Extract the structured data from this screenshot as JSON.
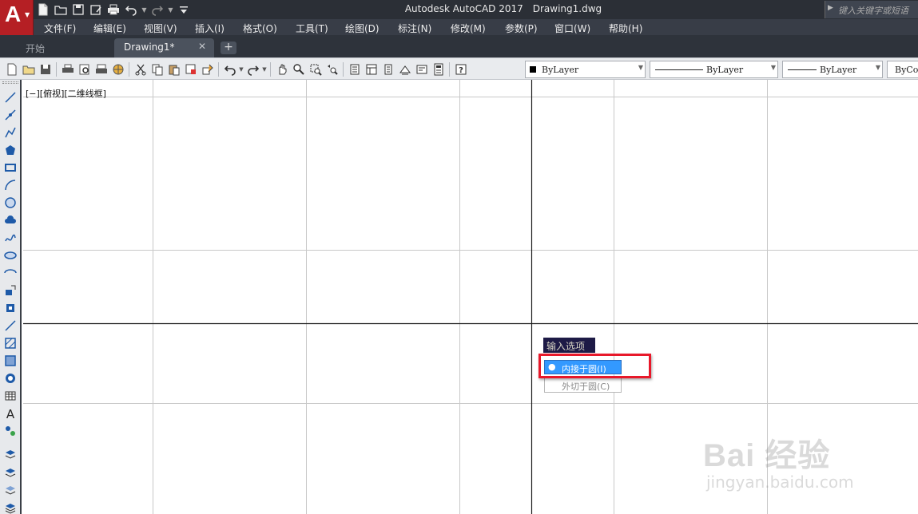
{
  "titlebar": {
    "app_logo": "A",
    "product": "Autodesk AutoCAD 2017",
    "document": "Drawing1.dwg",
    "search_placeholder": "键入关键字或短语",
    "colors": {
      "background": "#2b2f36",
      "app_button": "#b51f24"
    },
    "quick_access": [
      "new-file-icon",
      "open-folder-icon",
      "save-icon",
      "save-as-icon",
      "print-icon",
      "undo-icon",
      "redo-icon",
      "customize-menu-icon"
    ]
  },
  "menu": {
    "items": [
      "文件(F)",
      "编辑(E)",
      "视图(V)",
      "插入(I)",
      "格式(O)",
      "工具(T)",
      "绘图(D)",
      "标注(N)",
      "修改(M)",
      "参数(P)",
      "窗口(W)",
      "帮助(H)"
    ]
  },
  "tabs": {
    "start": "开始",
    "drawing": "Drawing1*",
    "close_symbol": "✕",
    "add_symbol": "+"
  },
  "toolbar": {
    "layer_value": "ByLayer",
    "linetype_value": "ByLayer",
    "lineweight_value": "ByLayer",
    "color_value": "ByCol",
    "icons": [
      "new-icon",
      "open-icon",
      "save-icon",
      "plot-icon",
      "plot-preview-icon",
      "publish-icon",
      "3d-print-icon",
      "cut-icon",
      "copy-icon",
      "paste-icon",
      "match-properties-icon",
      "block-editor-icon",
      "undo-icon",
      "redo-icon",
      "pan-icon",
      "zoom-realtime-icon",
      "zoom-window-icon",
      "zoom-previous-icon",
      "properties-icon",
      "design-center-icon",
      "tool-palettes-icon",
      "sheet-set-icon",
      "markup-icon",
      "quickcalc-icon",
      "help-icon"
    ]
  },
  "left_tools": [
    "line-icon",
    "construction-line-icon",
    "polyline-icon",
    "polygon-icon",
    "rectangle-icon",
    "arc-icon",
    "circle-icon",
    "revision-cloud-icon",
    "spline-icon",
    "ellipse-icon",
    "ellipse-arc-icon",
    "insert-block-icon",
    "make-block-icon",
    "point-icon",
    "hatch-icon",
    "gradient-icon",
    "region-icon",
    "table-icon",
    "multiline-text-icon",
    "add-selected-icon",
    "layer-tool-a-icon",
    "layer-tool-b-icon",
    "layer-tool-c-icon",
    "layer-tool-d-icon"
  ],
  "viewport": {
    "label": "[−][俯视][二维线框]"
  },
  "dynamic_input": {
    "title": "输入选项",
    "selected_marker": "●",
    "options": [
      "内接于圆(I)",
      "外切于圆(C)"
    ],
    "selected_index": 0,
    "colors": {
      "title_bg": "#1d1a46",
      "selected_bg": "#3399ff",
      "highlight_border": "#e8182a"
    }
  },
  "watermark": {
    "logo": "Bai 经验",
    "url": "jingyan.baidu.com"
  }
}
